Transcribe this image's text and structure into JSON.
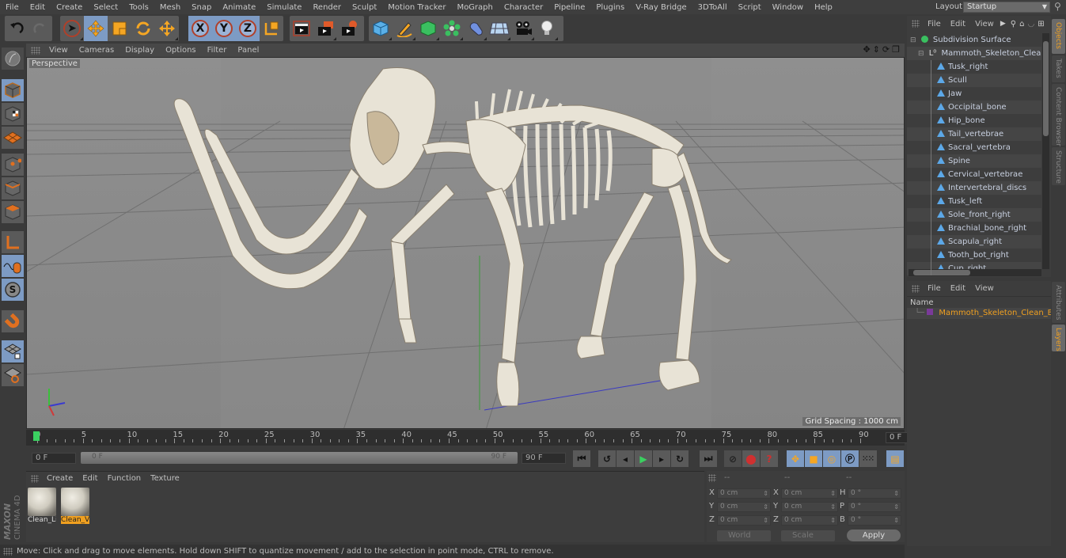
{
  "menubar": {
    "items": [
      "File",
      "Edit",
      "Create",
      "Select",
      "Tools",
      "Mesh",
      "Snap",
      "Animate",
      "Simulate",
      "Render",
      "Sculpt",
      "Motion Tracker",
      "MoGraph",
      "Character",
      "Pipeline",
      "Plugins",
      "V-Ray Bridge",
      "3DToAll",
      "Script",
      "Window",
      "Help"
    ],
    "layout_label": "Layout:",
    "layout_value": "Startup"
  },
  "toolbar": {
    "axis_x": "X",
    "axis_y": "Y",
    "axis_z": "Z",
    "active_tool": "move"
  },
  "viewport": {
    "menu": [
      "View",
      "Cameras",
      "Display",
      "Options",
      "Filter",
      "Panel"
    ],
    "camera_label": "Perspective",
    "grid_spacing": "Grid Spacing : 1000 cm",
    "colors": {
      "background": "#8a8a8a",
      "bone": "#e8e3d6",
      "grid": "#6a6a6a"
    }
  },
  "timeline": {
    "ticks": [
      "0",
      "5",
      "10",
      "15",
      "20",
      "25",
      "30",
      "35",
      "40",
      "45",
      "50",
      "55",
      "60",
      "65",
      "70",
      "75",
      "80",
      "85",
      "90"
    ],
    "current_frame": "0 F",
    "start_field": "0 F",
    "range_start": "0 F",
    "range_end": "90 F",
    "end_field": "90 F"
  },
  "materials": {
    "menu": [
      "Create",
      "Edit",
      "Function",
      "Texture"
    ],
    "items": [
      {
        "name": "Clean_Li",
        "selected": false
      },
      {
        "name": "Clean_V",
        "selected": true
      }
    ]
  },
  "coordinates": {
    "headers": [
      "--",
      "--",
      "--"
    ],
    "position": {
      "x": "0 cm",
      "y": "0 cm",
      "z": "0 cm"
    },
    "size": {
      "x": "0 cm",
      "y": "0 cm",
      "z": "0 cm"
    },
    "rotation": {
      "h": "0 °",
      "p": "0 °",
      "b": "0 °"
    },
    "labels": {
      "x": "X",
      "y": "Y",
      "z": "Z",
      "h": "H",
      "p": "P",
      "b": "B"
    },
    "mode_select": "World",
    "size_select": "Scale",
    "apply_label": "Apply"
  },
  "status_bar": "Move: Click and drag to move elements. Hold down SHIFT to quantize movement / add to the selection in point mode, CTRL to remove.",
  "object_manager": {
    "menu": [
      "File",
      "Edit",
      "View"
    ],
    "root": "Subdivision Surface",
    "group": "Mammoth_Skeleton_Clean_Bo",
    "children": [
      "Tusk_right",
      "Scull",
      "Jaw",
      "Occipital_bone",
      "Hip_bone",
      "Tail_vertebrae",
      "Sacral_vertebra",
      "Spine",
      "Cervical_vertebrae",
      "Intervertebral_discs",
      "Tusk_left",
      "Sole_front_right",
      "Brachial_bone_right",
      "Scapula_right",
      "Tooth_bot_right",
      "Cup_right"
    ]
  },
  "layer_manager": {
    "menu": [
      "File",
      "Edit",
      "View"
    ],
    "column_header": "Name",
    "layers": [
      {
        "name": "Mammoth_Skeleton_Clean_Bones",
        "color": "#7a3a9a"
      }
    ]
  },
  "right_tabs": {
    "top": [
      {
        "label": "Objects",
        "active": true
      },
      {
        "label": "Takes",
        "active": false
      },
      {
        "label": "Content Browser",
        "active": false
      },
      {
        "label": "Structure",
        "active": false
      }
    ],
    "bottom": [
      {
        "label": "Attributes",
        "active": false
      },
      {
        "label": "Layers",
        "active": true
      }
    ]
  },
  "brand": {
    "line1": "MAXON",
    "line2": "CINEMA 4D"
  },
  "colors": {
    "accent": "#f0a020",
    "active_button": "#7d9bc4",
    "panel": "#3d3d3d",
    "play_green": "#3ad060"
  }
}
